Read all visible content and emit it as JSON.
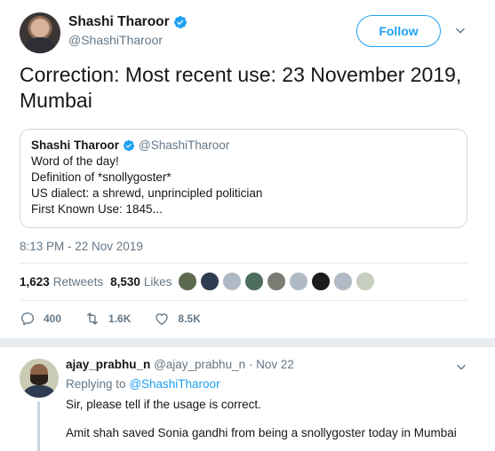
{
  "tweet": {
    "author_name": "Shashi Tharoor",
    "author_handle": "@ShashiTharoor",
    "follow_label": "Follow",
    "text": "Correction: Most recent use: 23 November 2019, Mumbai",
    "quoted": {
      "author_name": "Shashi Tharoor",
      "author_handle": "@ShashiTharoor",
      "lines": [
        "Word of the day!",
        "Definition of *snollygoster*",
        "US dialect: a shrewd, unprincipled politician",
        "First Known Use: 1845..."
      ]
    },
    "timestamp": "8:13 PM - 22 Nov 2019",
    "stats": {
      "retweets_count": "1,623",
      "retweets_label": "Retweets",
      "likes_count": "8,530",
      "likes_label": "Likes"
    },
    "liker_avatar_colors": [
      "#5d6a4f",
      "#2f3b4e",
      "#b0bac4",
      "#4d6d5e",
      "#7c7c74",
      "#b0bac4",
      "#1c1c1c",
      "#b0bac4",
      "#c7cdbf"
    ],
    "actions": {
      "replies": "400",
      "retweets": "1.6K",
      "likes": "8.5K"
    }
  },
  "reply": {
    "author_name": "ajay_prabhu_n",
    "author_handle": "@ajay_prabhu_n",
    "date": "· Nov 22",
    "replying_prefix": "Replying to",
    "replying_to": "@ShashiTharoor",
    "text1": "Sir, please tell if the usage is correct.",
    "text2": "Amit shah saved Sonia gandhi from being a snollygoster today in Mumbai"
  },
  "colors": {
    "accent": "#1da1f2",
    "secondary_text": "#657786",
    "border": "#ccd6dd"
  },
  "icons": [
    "verified-badge-icon",
    "chevron-down-icon",
    "reply-icon",
    "retweet-icon",
    "like-heart-icon"
  ]
}
